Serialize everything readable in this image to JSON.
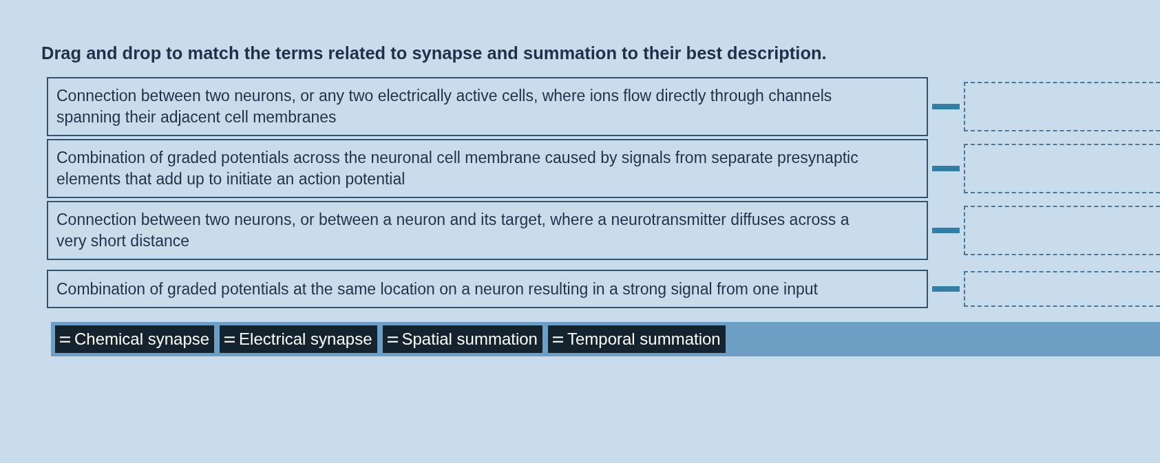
{
  "instruction": "Drag and drop to match the terms related to synapse and summation to their best description.",
  "descriptions": [
    {
      "text": "Connection between two neurons, or any two electrically active cells, where ions flow directly through channels spanning their adjacent cell membranes"
    },
    {
      "text": "Combination of graded potentials across the neuronal cell membrane caused by signals from separate presynaptic elements that add up to initiate an action potential"
    },
    {
      "text": "Connection between two neurons, or between a neuron and its target, where a neurotransmitter diffuses across a very short distance"
    },
    {
      "text": "Combination of graded potentials at the same location on a neuron resulting in a strong signal from one input"
    }
  ],
  "answer_choices": [
    {
      "label": "Chemical synapse"
    },
    {
      "label": "Electrical synapse"
    },
    {
      "label": "Spatial summation"
    },
    {
      "label": "Temporal summation"
    }
  ]
}
